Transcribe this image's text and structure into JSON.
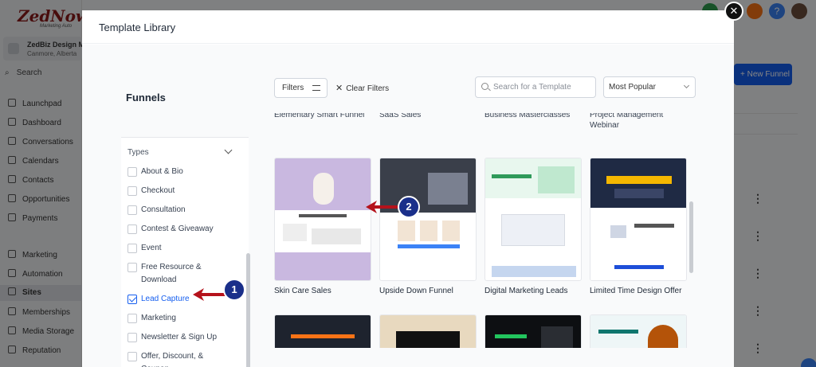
{
  "background_app": {
    "logo_text": "ZedNow",
    "logo_tagline": "Marketing Auto",
    "account_name": "ZedBiz Design Mktg",
    "account_location": "Canmore, Alberta",
    "search_label": "Search",
    "nav_items": [
      "Launchpad",
      "Dashboard",
      "Conversations",
      "Calendars",
      "Contacts",
      "Opportunities",
      "Payments",
      "Marketing",
      "Automation",
      "Sites",
      "Memberships",
      "Media Storage",
      "Reputation"
    ],
    "active_nav": "Sites",
    "new_funnel_label": "+ New Funnel",
    "help_label": "?"
  },
  "modal": {
    "title": "Template Library",
    "close_label": "✕",
    "section_title": "Funnels",
    "filters_label": "Filters",
    "clear_filters_label": "Clear Filters",
    "search_placeholder": "Search for a Template",
    "sort_value": "Most Popular",
    "types_label": "Types",
    "types": [
      {
        "label": "About & Bio",
        "checked": false
      },
      {
        "label": "Checkout",
        "checked": false
      },
      {
        "label": "Consultation",
        "checked": false
      },
      {
        "label": "Contest & Giveaway",
        "checked": false
      },
      {
        "label": "Event",
        "checked": false
      },
      {
        "label": "Free Resource & Download",
        "checked": false
      },
      {
        "label": "Lead Capture",
        "checked": true
      },
      {
        "label": "Marketing",
        "checked": false
      },
      {
        "label": "Newsletter & Sign Up",
        "checked": false
      },
      {
        "label": "Offer, Discount, & Coupon",
        "checked": false
      }
    ],
    "previous_row_titles": [
      "Elementary Smart Funnel",
      "SaaS Sales",
      "Business Masterclasses",
      "Project Management Webinar"
    ],
    "templates_row1": [
      "Skin Care Sales",
      "Upside Down Funnel",
      "Digital Marketing Leads",
      "Limited Time Design Offer"
    ]
  },
  "annotations": [
    {
      "number": "1",
      "color": "#1a2f8a",
      "arrow_color": "#b5121b"
    },
    {
      "number": "2",
      "color": "#1a2f8a",
      "arrow_color": "#b5121b"
    }
  ]
}
